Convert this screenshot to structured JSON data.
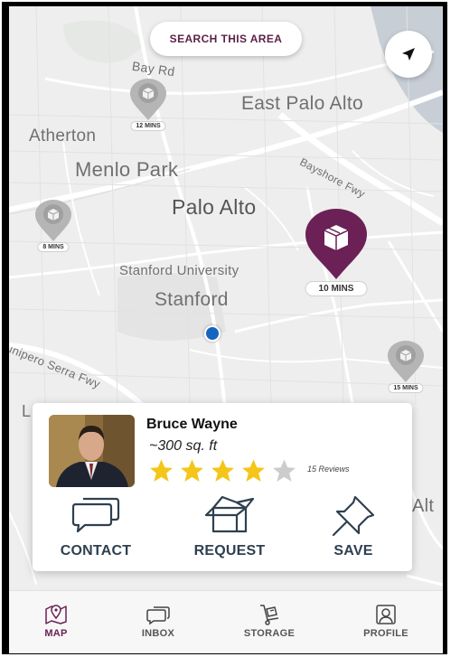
{
  "map": {
    "labels": {
      "bay_rd": "Bay Rd",
      "east_palo_alto": "East Palo Alto",
      "atherton": "Atherton",
      "menlo_park": "Menlo Park",
      "bayshore_fwy": "Bayshore Fwy",
      "palo_alto": "Palo Alto",
      "stanford_university": "Stanford University",
      "stanford": "Stanford",
      "junipero_serra_fwy": "unipero Serra Fwy",
      "alt_partial": "Alt",
      "l_partial": "L"
    },
    "search_button": "SEARCH THIS AREA",
    "pins": [
      {
        "time": "12 MINS",
        "selected": false
      },
      {
        "time": "8 MINS",
        "selected": false
      },
      {
        "time": "10 MINS",
        "selected": true
      },
      {
        "time": "15 MINS",
        "selected": false
      }
    ]
  },
  "listing": {
    "name": "Bruce Wayne",
    "size": "~300 sq. ft",
    "rating": 4,
    "rating_max": 5,
    "reviews": "15 Reviews",
    "actions": {
      "contact": "CONTACT",
      "request": "REQUEST",
      "save": "SAVE"
    }
  },
  "nav": {
    "map": "MAP",
    "inbox": "INBOX",
    "storage": "STORAGE",
    "profile": "PROFILE",
    "active": "map"
  },
  "colors": {
    "brand": "#6b2156",
    "pin_gray": "#b5b5b5",
    "user_dot": "#1565c0",
    "star": "#f5c518",
    "star_empty": "#cccccc",
    "action_text": "#2f4050"
  }
}
